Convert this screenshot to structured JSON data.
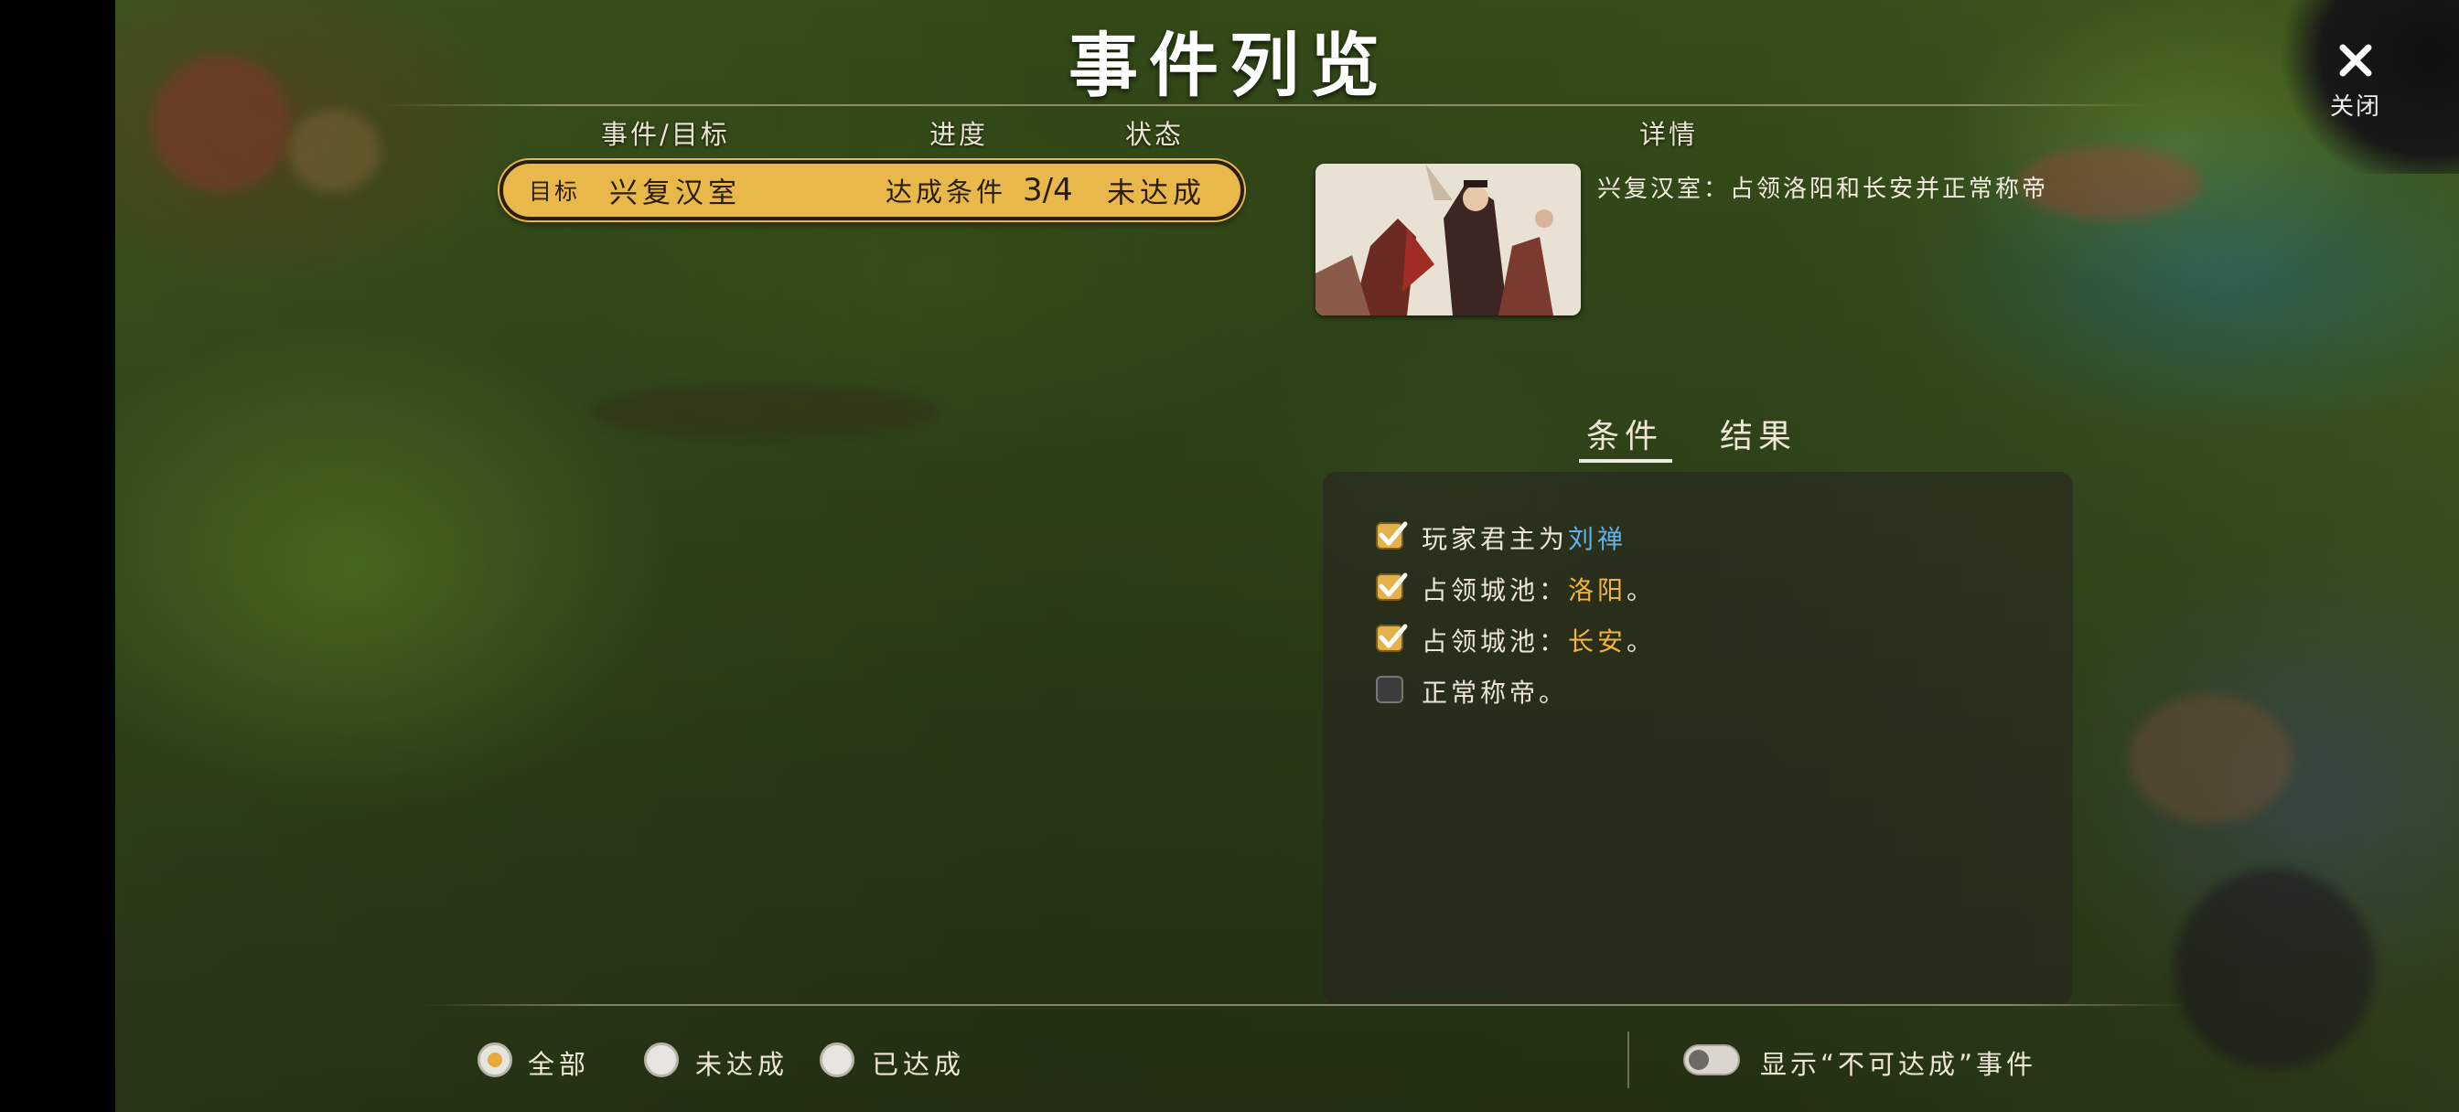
{
  "title": "事件列览",
  "close_label": "关闭",
  "columns": {
    "event": "事件/目标",
    "progress": "进度",
    "status": "状态",
    "detail": "详情"
  },
  "event": {
    "type": "目标",
    "name": "兴复汉室",
    "progress_label": "达成条件",
    "progress": "3/4",
    "status": "未达成"
  },
  "detail": {
    "description": "兴复汉室：占领洛阳和长安并正常称帝"
  },
  "tabs": [
    "条件",
    "结果"
  ],
  "conditions": [
    {
      "checked": true,
      "parts": [
        "玩家君主为",
        "刘禅",
        ""
      ]
    },
    {
      "checked": true,
      "parts": [
        "占领城池：",
        "洛阳",
        "。"
      ]
    },
    {
      "checked": true,
      "parts": [
        "占领城池：",
        "长安",
        "。"
      ]
    },
    {
      "checked": false,
      "parts": [
        "正常称帝。",
        "",
        ""
      ]
    }
  ],
  "filters": {
    "all": "全部",
    "incomplete": "未达成",
    "complete": "已达成",
    "selected": "all"
  },
  "toggle_label": "显示“不可达成”事件",
  "colors": {
    "accent_gold": "#e8b94a",
    "highlight_blue": "#5fb3e8",
    "highlight_gold": "#f0b53a"
  }
}
